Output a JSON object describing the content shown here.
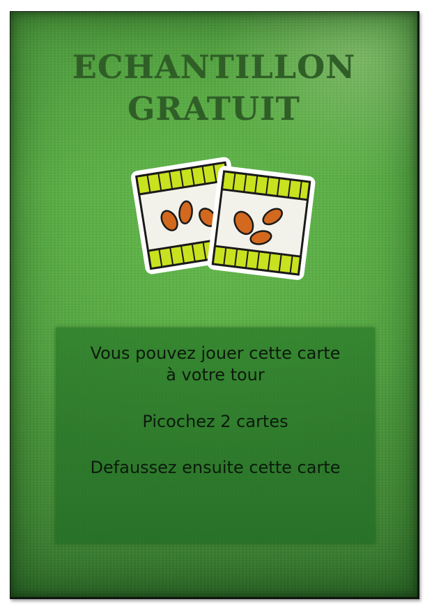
{
  "card": {
    "title_line1": "ECHANTILLON",
    "title_line2": "GRATUIT",
    "illustration": "seed-packets-icon",
    "rules": {
      "line1a": "Vous pouvez jouer cette carte",
      "line1b": "à votre tour",
      "line2": "Picochez 2 cartes",
      "line3": "Defaussez ensuite cette carte"
    }
  },
  "colors": {
    "card_green": "#4f9f3e",
    "title_dark_green": "#2f5e27",
    "panel_green": "#2a7a2a",
    "packet_yellow": "#c9e21f",
    "seed_orange": "#d2691e"
  }
}
